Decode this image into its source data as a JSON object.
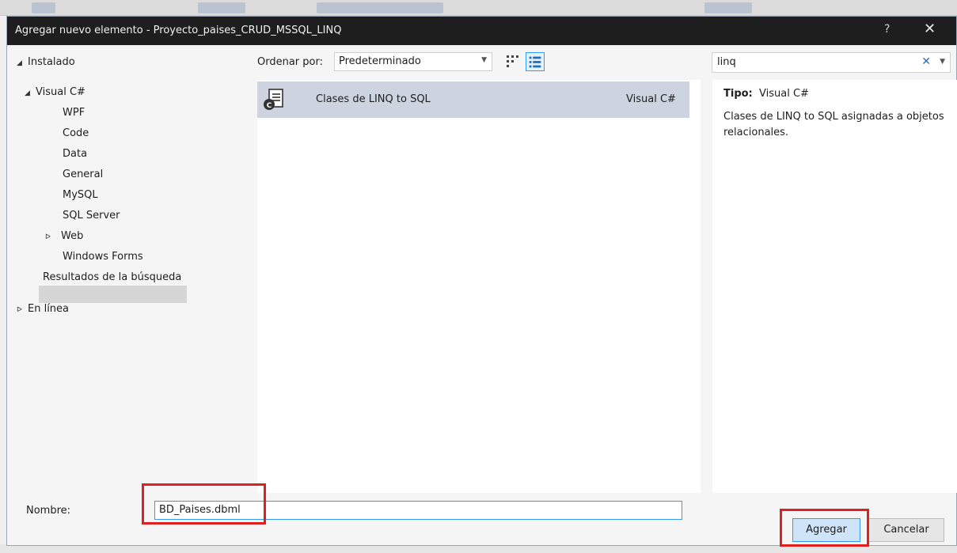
{
  "window": {
    "title": "Agregar nuevo elemento - Proyecto_paises_CRUD_MSSQL_LINQ",
    "help": "?",
    "close": "✕"
  },
  "tree": {
    "installed": "Instalado",
    "visual_csharp": "Visual C#",
    "items": [
      "WPF",
      "Code",
      "Data",
      "General",
      "MySQL",
      "SQL Server",
      "Web",
      "Windows Forms"
    ],
    "search_results": "Resultados de la búsqueda",
    "online": "En línea"
  },
  "sort": {
    "label": "Ordenar por:",
    "value": "Predeterminado"
  },
  "results": [
    {
      "name": "Clases de LINQ to SQL",
      "language": "Visual C#"
    }
  ],
  "search": {
    "value": "linq"
  },
  "info": {
    "type_label": "Tipo:",
    "type_value": "Visual C#",
    "description": "Clases de LINQ to SQL asignadas a objetos relacionales."
  },
  "name_field": {
    "label": "Nombre:",
    "value": "BD_Paises.dbml"
  },
  "buttons": {
    "add": "Agregar",
    "cancel": "Cancelar"
  },
  "colors": {
    "accent": "#3399ff",
    "highlight": "#e02020",
    "selection": "#cdd4df"
  }
}
